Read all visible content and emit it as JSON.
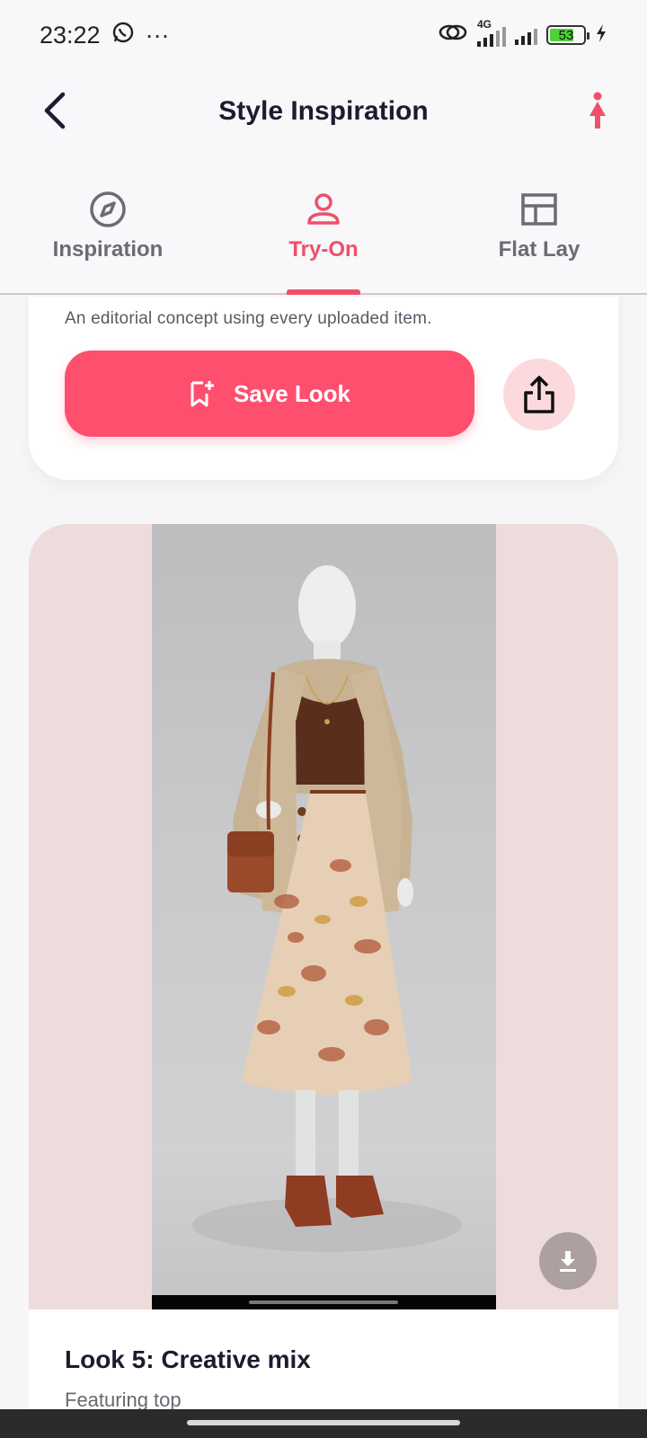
{
  "status_bar": {
    "time": "23:22",
    "more": "···",
    "network": "4G",
    "battery": "53",
    "icons": [
      "whatsapp-icon",
      "link-icon",
      "signal-icon",
      "battery-icon",
      "charging-icon"
    ]
  },
  "app_bar": {
    "title": "Style Inspiration",
    "back_icon": "chevron-left-icon",
    "action_icon": "person-icon"
  },
  "tabs": [
    {
      "label": "Inspiration",
      "icon": "compass-icon",
      "active": false
    },
    {
      "label": "Try-On",
      "icon": "user-icon",
      "active": true
    },
    {
      "label": "Flat Lay",
      "icon": "layout-icon",
      "active": false
    }
  ],
  "concept_card": {
    "description": "An editorial concept using every uploaded item.",
    "save_label": "Save Look",
    "save_icon": "bookmark-add-icon",
    "share_icon": "share-icon"
  },
  "look": {
    "title": "Look 5: Creative mix",
    "subtitle": "Featuring top",
    "download_icon": "download-icon"
  },
  "colors": {
    "accent": "#f04f6a",
    "button": "#ff4f6e",
    "share_bg": "#fcd9dd",
    "image_bg": "#eedcdc"
  }
}
